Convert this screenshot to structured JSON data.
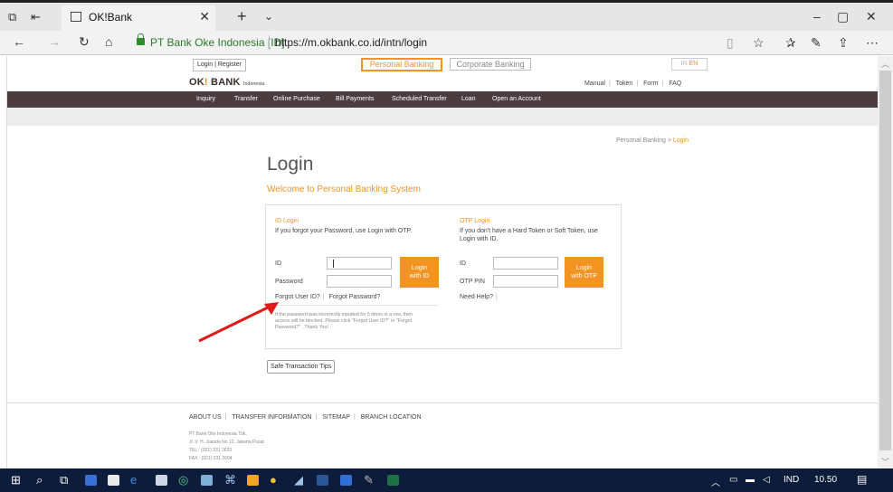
{
  "browser": {
    "tab_title": "OK!Bank",
    "site_identity": "PT Bank Oke Indonesia [ID]",
    "url": "https://m.okbank.co.id/intn/login"
  },
  "header": {
    "login_register": "Login",
    "register": "Register",
    "pipe": "|",
    "personal_banking": "Personal Banking",
    "corporate_banking": "Corporate Banking",
    "lang_in": "IN",
    "lang_en": "EN",
    "logo_ok": "OK",
    "logo_bank": "BANK",
    "logo_indonesia": "Indonesia",
    "util_links": [
      "Manual",
      "Token",
      "Form",
      "FAQ"
    ]
  },
  "menu": [
    "Inquiry",
    "Transfer",
    "Online Purchase",
    "Bill Payments",
    "Scheduled Transfer",
    "Loan",
    "Open an Account"
  ],
  "breadcrumb": {
    "parent": "Personal Banking",
    "separator": ">",
    "current": "Login"
  },
  "main": {
    "title": "Login",
    "subtitle": "Welcome to Personal Banking System"
  },
  "id_login": {
    "title": "ID Login",
    "description": "If you forgot your Password, use Login with OTP.",
    "id_label": "ID",
    "password_label": "Password",
    "button": [
      "Login",
      "with ID"
    ],
    "forgot_user_id": "Forgot User ID?",
    "forgot_password": "Forgot Password?",
    "note": "If the password was incorrectly inputted for 5 times in a row, then access will be blocked. Please click \"Forgot User ID?\" or \"Forgot Password?\" . Thank You!"
  },
  "otp_login": {
    "title": "OTP Login",
    "description": "If you don't have a Hard Token or Soft Token, use Login with ID.",
    "id_label": "ID",
    "otp_label": "OTP PIN",
    "button": [
      "Login",
      "with OTP"
    ],
    "need_help": "Need Help?"
  },
  "tips_button": "Safe Transaction Tips",
  "footer": {
    "links": [
      "ABOUT US",
      "TRANSFER INFORMATION",
      "SITEMAP",
      "BRANCH LOCATION"
    ],
    "address": [
      "PT Bank Oke Indonesia Tbk.",
      "Jl. Ir. H. Juanda No 12, Jakarta Pusat",
      "TEL : (021) 231 2633",
      "FAX : (021) 231 2604"
    ]
  },
  "taskbar": {
    "lang": "IND",
    "time": "10.50"
  },
  "colors": {
    "accent": "#f39322",
    "menubar": "#4b3c3f",
    "annotation_arrow": "#e01a1a"
  }
}
